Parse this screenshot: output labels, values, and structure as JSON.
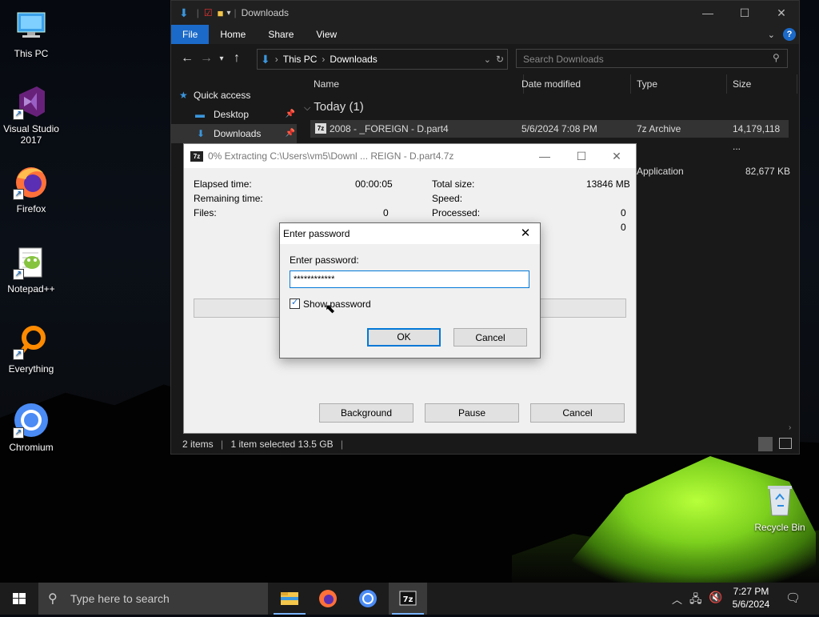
{
  "desktop": {
    "icons": [
      {
        "label": "This PC"
      },
      {
        "label": "Visual Studio 2017"
      },
      {
        "label": "Firefox"
      },
      {
        "label": "Notepad++"
      },
      {
        "label": "Everything"
      },
      {
        "label": "Chromium"
      }
    ],
    "recycle_bin": "Recycle Bin"
  },
  "explorer": {
    "title": "Downloads",
    "ribbon_tabs": [
      "File",
      "Home",
      "Share",
      "View"
    ],
    "breadcrumb": [
      "This PC",
      "Downloads"
    ],
    "search_placeholder": "Search Downloads",
    "nav": {
      "quick_access": "Quick access",
      "desktop": "Desktop",
      "downloads": "Downloads"
    },
    "columns": {
      "name": "Name",
      "date": "Date modified",
      "type": "Type",
      "size": "Size"
    },
    "group": "Today (1)",
    "file": {
      "name": "2008 - _FOREIGN - D.part4",
      "date": "5/6/2024 7:08 PM",
      "type": "7z Archive",
      "size": "14,179,118 ..."
    },
    "file2": {
      "type": "Application",
      "size": "82,677 KB"
    },
    "status": {
      "items": "2 items",
      "selected": "1 item selected  13.5 GB"
    }
  },
  "extract": {
    "title": "0% Extracting C:\\Users\\vm5\\Downl ... REIGN - D.part4.7z",
    "elapsed_label": "Elapsed time:",
    "elapsed": "00:00:05",
    "remaining_label": "Remaining time:",
    "files_label": "Files:",
    "files": "0",
    "total_label": "Total size:",
    "total": "13846 MB",
    "speed_label": "Speed:",
    "processed_label": "Processed:",
    "processed": "0",
    "extra_value": "0",
    "buttons": {
      "background": "Background",
      "pause": "Pause",
      "cancel": "Cancel"
    }
  },
  "password": {
    "title": "Enter password",
    "label": "Enter password:",
    "value": "************",
    "show_label": "Show password",
    "ok": "OK",
    "cancel": "Cancel"
  },
  "taskbar": {
    "search_placeholder": "Type here to search",
    "time": "7:27 PM",
    "date": "5/6/2024"
  }
}
